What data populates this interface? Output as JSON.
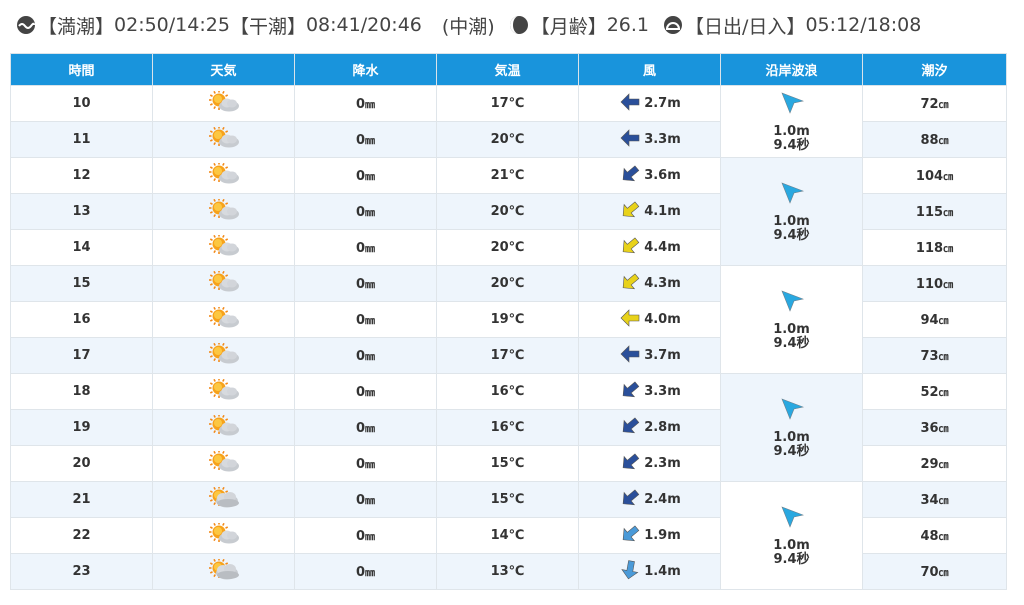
{
  "info": {
    "high_tide_label": "【満潮】",
    "high_tide": "02:50/14:25",
    "low_tide_label": "【干潮】",
    "low_tide": "08:41/20:46",
    "tide_type": "(中潮)",
    "moon_age_label": "【月齢】",
    "moon_age": "26.1",
    "sun_label": "【日出/日入】",
    "sun": "05:12/18:08",
    "icons": [
      "tide-icon",
      "moon-icon",
      "sunrise-icon"
    ]
  },
  "headers": [
    "時間",
    "天気",
    "降水",
    "気温",
    "風",
    "沿岸波浪",
    "潮汐"
  ],
  "rows": [
    {
      "hour": "10",
      "weather": "sun-cloud",
      "precip": "0",
      "precip_unit": "㎜",
      "temp": "17℃",
      "wind": "2.7m",
      "wind_dir": "east",
      "wind_color": "#2a4f9a",
      "tide": "72",
      "tide_unit": "㎝"
    },
    {
      "hour": "11",
      "weather": "sun-cloud",
      "precip": "0",
      "precip_unit": "㎜",
      "temp": "20℃",
      "wind": "3.3m",
      "wind_dir": "east",
      "wind_color": "#2a4f9a",
      "tide": "88",
      "tide_unit": "㎝"
    },
    {
      "hour": "12",
      "weather": "sun-cloud",
      "precip": "0",
      "precip_unit": "㎜",
      "temp": "21℃",
      "wind": "3.6m",
      "wind_dir": "northeast",
      "wind_color": "#2a4f9a",
      "tide": "104",
      "tide_unit": "㎝"
    },
    {
      "hour": "13",
      "weather": "sun-cloud",
      "precip": "0",
      "precip_unit": "㎜",
      "temp": "20℃",
      "wind": "4.1m",
      "wind_dir": "northeast",
      "wind_color": "#e8d21a",
      "tide": "115",
      "tide_unit": "㎝"
    },
    {
      "hour": "14",
      "weather": "sun-cloud",
      "precip": "0",
      "precip_unit": "㎜",
      "temp": "20℃",
      "wind": "4.4m",
      "wind_dir": "northeast",
      "wind_color": "#e8d21a",
      "tide": "118",
      "tide_unit": "㎝"
    },
    {
      "hour": "15",
      "weather": "sun-cloud",
      "precip": "0",
      "precip_unit": "㎜",
      "temp": "20℃",
      "wind": "4.3m",
      "wind_dir": "northeast",
      "wind_color": "#e8d21a",
      "tide": "110",
      "tide_unit": "㎝"
    },
    {
      "hour": "16",
      "weather": "sun-cloud",
      "precip": "0",
      "precip_unit": "㎜",
      "temp": "19℃",
      "wind": "4.0m",
      "wind_dir": "east",
      "wind_color": "#e8d21a",
      "tide": "94",
      "tide_unit": "㎝"
    },
    {
      "hour": "17",
      "weather": "sun-cloud",
      "precip": "0",
      "precip_unit": "㎜",
      "temp": "17℃",
      "wind": "3.7m",
      "wind_dir": "east",
      "wind_color": "#2a4f9a",
      "tide": "73",
      "tide_unit": "㎝"
    },
    {
      "hour": "18",
      "weather": "sun-cloud",
      "precip": "0",
      "precip_unit": "㎜",
      "temp": "16℃",
      "wind": "3.3m",
      "wind_dir": "northeast",
      "wind_color": "#2a4f9a",
      "tide": "52",
      "tide_unit": "㎝"
    },
    {
      "hour": "19",
      "weather": "sun-cloud",
      "precip": "0",
      "precip_unit": "㎜",
      "temp": "16℃",
      "wind": "2.8m",
      "wind_dir": "northeast",
      "wind_color": "#2a4f9a",
      "tide": "36",
      "tide_unit": "㎝"
    },
    {
      "hour": "20",
      "weather": "sun-cloud",
      "precip": "0",
      "precip_unit": "㎜",
      "temp": "15℃",
      "wind": "2.3m",
      "wind_dir": "northeast",
      "wind_color": "#2a4f9a",
      "tide": "29",
      "tide_unit": "㎝"
    },
    {
      "hour": "21",
      "weather": "cloud-sun",
      "precip": "0",
      "precip_unit": "㎜",
      "temp": "15℃",
      "wind": "2.4m",
      "wind_dir": "northeast",
      "wind_color": "#2a4f9a",
      "tide": "34",
      "tide_unit": "㎝"
    },
    {
      "hour": "22",
      "weather": "sun-cloud",
      "precip": "0",
      "precip_unit": "㎜",
      "temp": "14℃",
      "wind": "1.9m",
      "wind_dir": "northeast",
      "wind_color": "#4a9ad8",
      "tide": "48",
      "tide_unit": "㎝"
    },
    {
      "hour": "23",
      "weather": "cloud-sun",
      "precip": "0",
      "precip_unit": "㎜",
      "temp": "13℃",
      "wind": "1.4m",
      "wind_dir": "north",
      "wind_color": "#4a9ad8",
      "tide": "70",
      "tide_unit": "㎝"
    }
  ],
  "waves": [
    {
      "height": "1.0m",
      "period": "9.4秒",
      "direction": "southeast-arrow",
      "color": "#29a8e0"
    },
    {
      "height": "1.0m",
      "period": "9.4秒",
      "direction": "southeast-arrow",
      "color": "#29a8e0"
    },
    {
      "height": "1.0m",
      "period": "9.4秒",
      "direction": "southeast-arrow",
      "color": "#29a8e0"
    },
    {
      "height": "1.0m",
      "period": "9.4秒",
      "direction": "southeast-arrow",
      "color": "#29a8e0"
    },
    {
      "height": "1.0m",
      "period": "9.4秒",
      "direction": "southeast-arrow",
      "color": "#29a8e0"
    }
  ],
  "wave_spans": [
    2,
    3,
    3,
    3,
    3
  ],
  "colors": {
    "header_bg": "#1994dc",
    "row_alt": "#eef5fc",
    "wave_arrow": "#29a8e0"
  }
}
